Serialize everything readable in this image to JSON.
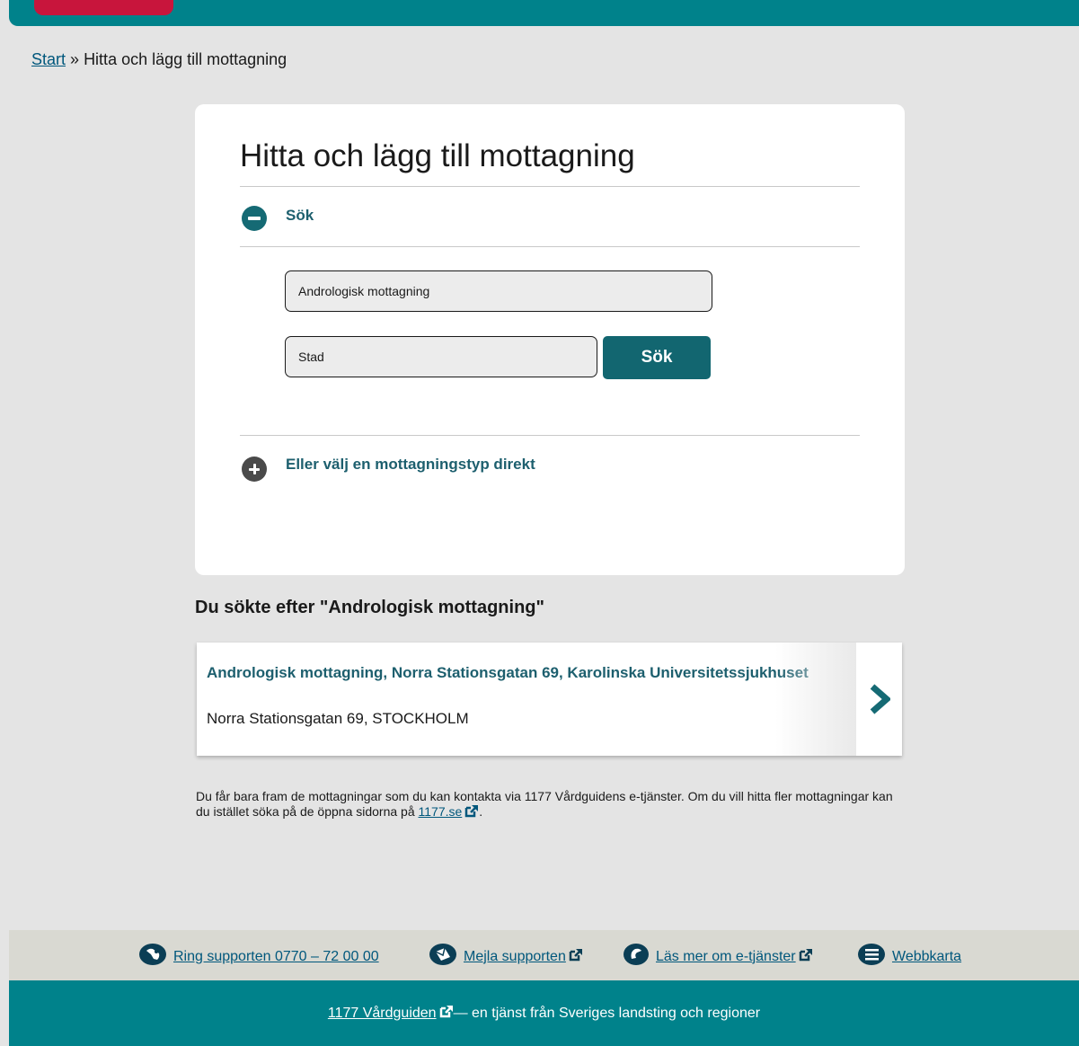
{
  "breadcrumb": {
    "start": "Start",
    "separator": "»",
    "current": "Hitta och lägg till mottagning"
  },
  "card": {
    "title": "Hitta och lägg till mottagning",
    "search_section": {
      "label": "Sök",
      "expanded": true,
      "query_value": "Andrologisk mottagning",
      "city_placeholder": "Stad",
      "button_label": "Sök"
    },
    "type_section": {
      "label": "Eller välj en mottagningstyp direkt",
      "expanded": false
    }
  },
  "results": {
    "heading": "Du sökte efter \"Andrologisk mottagning\"",
    "items": [
      {
        "title": "Andrologisk mottagning, Norra Stationsgatan 69, Karolinska Universitetssjukhuset",
        "address": "Norra Stationsgatan 69, STOCKHOLM"
      }
    ]
  },
  "note": {
    "text": "Du får bara fram de mottagningar som du kan kontakta via 1177 Vårdguidens e-tjänster. Om du vill hitta fler mottagningar kan du istället söka på de öppna sidorna på ",
    "link": "1177.se",
    "suffix": "."
  },
  "footer": {
    "links": [
      {
        "label": "Ring supporten 0770 – 72 00 00",
        "icon": "phone-icon"
      },
      {
        "label": "Mejla supporten",
        "icon": "email-icon"
      },
      {
        "label": "Läs mer om e-tjänster",
        "icon": "info-icon"
      },
      {
        "label": "Webbkarta",
        "icon": "sitemap-icon"
      }
    ],
    "bottom_link": "1177 Vårdguiden",
    "bottom_text": " — en tjänst från Sveriges landsting och regioner"
  },
  "colors": {
    "brand_teal": "#00828b",
    "brand_red": "#c8153c",
    "link_teal": "#1d5f6e",
    "button": "#126670"
  }
}
